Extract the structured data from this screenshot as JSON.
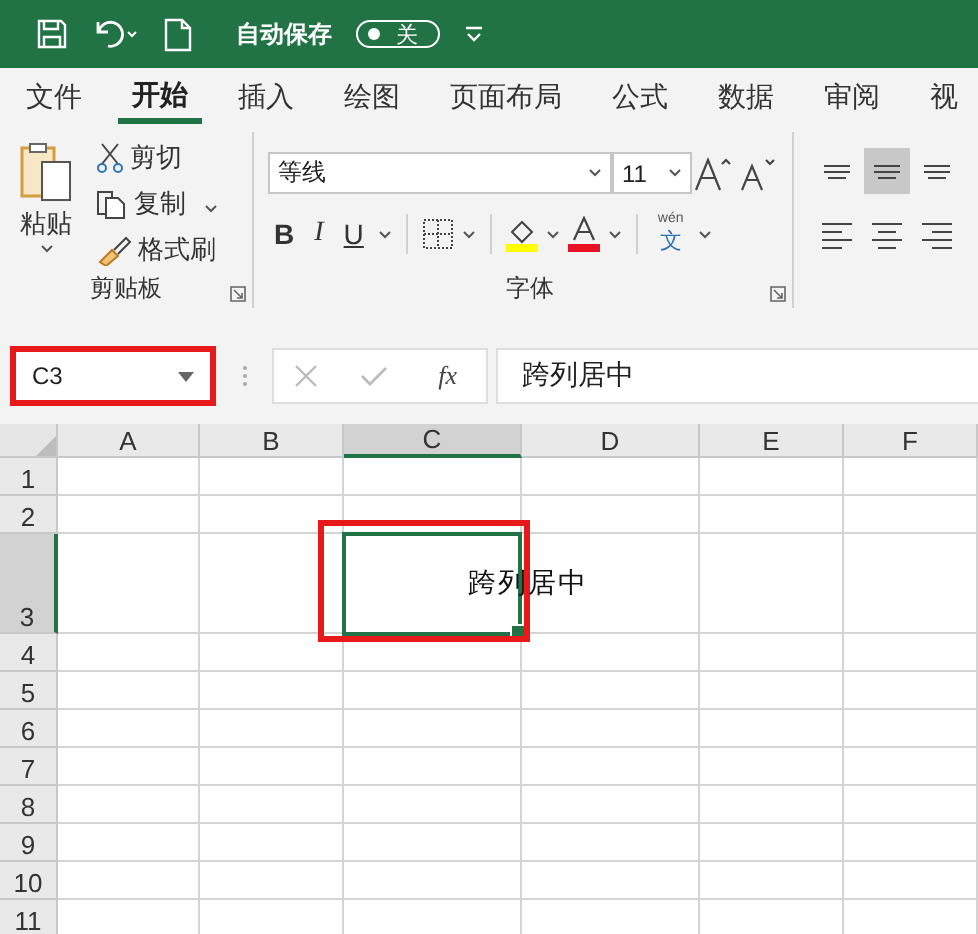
{
  "title_bar": {
    "autosave_label": "自动保存",
    "autosave_on": false,
    "autosave_state": "关"
  },
  "tabs": [
    {
      "label": "文件",
      "selected": false
    },
    {
      "label": "开始",
      "selected": true
    },
    {
      "label": "插入",
      "selected": false
    },
    {
      "label": "绘图",
      "selected": false
    },
    {
      "label": "页面布局",
      "selected": false
    },
    {
      "label": "公式",
      "selected": false
    },
    {
      "label": "数据",
      "selected": false
    },
    {
      "label": "审阅",
      "selected": false
    },
    {
      "label": "视",
      "selected": false
    }
  ],
  "clipboard": {
    "paste": "粘贴",
    "cut": "剪切",
    "copy": "复制",
    "format_painter": "格式刷",
    "group_label": "剪贴板"
  },
  "font": {
    "font_name": "等线",
    "font_size": "11",
    "bold": "B",
    "italic": "I",
    "underline": "U",
    "phonetic": "wén",
    "phonetic_char": "文",
    "group_label": "字体"
  },
  "alignment": {
    "buttons": [
      {
        "kind": "top",
        "selected": false
      },
      {
        "kind": "middle",
        "selected": true
      },
      {
        "kind": "bottom",
        "selected": false
      },
      {
        "kind": "left",
        "selected": false
      },
      {
        "kind": "center",
        "selected": false
      },
      {
        "kind": "right",
        "selected": false
      }
    ]
  },
  "formula_bar": {
    "name_box": "C3",
    "name_box_highlighted": true,
    "function_label": "fx",
    "value": "跨列居中"
  },
  "sheet": {
    "columns": [
      {
        "label": "A",
        "selected": false
      },
      {
        "label": "B",
        "selected": false
      },
      {
        "label": "C",
        "selected": true
      },
      {
        "label": "D",
        "selected": false
      },
      {
        "label": "E",
        "selected": false
      },
      {
        "label": "F",
        "selected": false
      }
    ],
    "rows": [
      {
        "label": "1",
        "selected": false
      },
      {
        "label": "2",
        "selected": false
      },
      {
        "label": "3",
        "selected": true,
        "cell_text": "跨列居中"
      },
      {
        "label": "4",
        "selected": false
      },
      {
        "label": "5",
        "selected": false
      },
      {
        "label": "6",
        "selected": false
      },
      {
        "label": "7",
        "selected": false
      },
      {
        "label": "8",
        "selected": false
      },
      {
        "label": "9",
        "selected": false
      },
      {
        "label": "10",
        "selected": false
      },
      {
        "label": "11",
        "selected": false
      }
    ],
    "active_cell_highlighted": true
  }
}
